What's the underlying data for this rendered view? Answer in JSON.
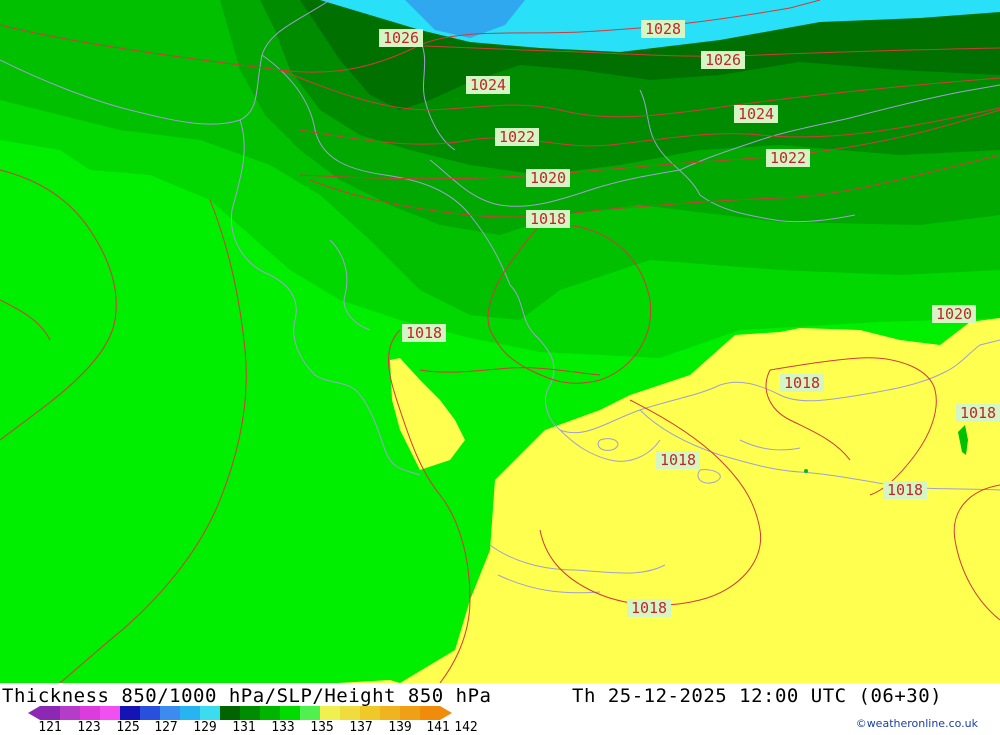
{
  "title": "Thickness 850/1000 hPa/SLP/Height 850 hPa",
  "datetime": "Th 25-12-2025 12:00 UTC (06+30)",
  "credit": "©weatheronline.co.uk",
  "isobar_labels": [
    "1026",
    "1028",
    "1026",
    "1024",
    "1024",
    "1022",
    "1022",
    "1020",
    "1018",
    "1020",
    "1018",
    "1018",
    "1018",
    "1018",
    "1018",
    "1018"
  ],
  "legend": {
    "ticks": [
      "121",
      "123",
      "125",
      "127",
      "129",
      "131",
      "133",
      "135",
      "137",
      "139",
      "141",
      "142"
    ],
    "colors": [
      "#8c28b4",
      "#b43cc8",
      "#dc3cdc",
      "#f050f0",
      "#1414b4",
      "#2850dc",
      "#3c8cf0",
      "#28b4f0",
      "#3cdcf0",
      "#006400",
      "#008c00",
      "#00b400",
      "#00dc00",
      "#50f050",
      "#f0f050",
      "#f0dc3c",
      "#f0c828",
      "#f0b41e",
      "#f0a014",
      "#f08c0a"
    ]
  },
  "colors": {
    "sea_cyan": "#28e0f8",
    "sea_blue": "#2fa8f0",
    "green_bright": "#00ee00",
    "green_1": "#00d800",
    "green_2": "#00c000",
    "green_3": "#00a800",
    "green_4": "#008c00",
    "green_5": "#007000",
    "yellow": "#ffff50",
    "isobar": "#d23a3a",
    "coast": "#a0a0d0"
  }
}
